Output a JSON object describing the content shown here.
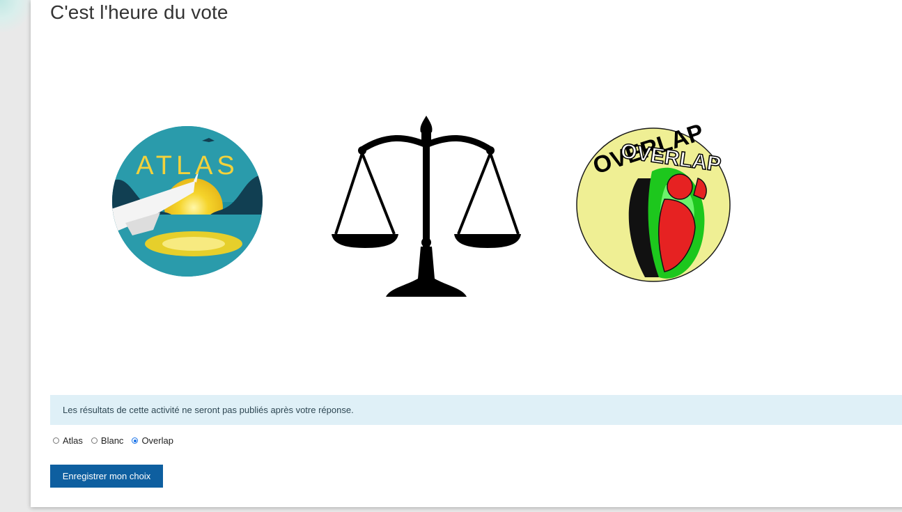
{
  "page": {
    "title": "C'est l'heure du vote"
  },
  "images": [
    {
      "name": "atlas-logo",
      "text": "ATLAS"
    },
    {
      "name": "scales-of-justice-icon"
    },
    {
      "name": "overlap-logo",
      "text": "OVERLAP"
    }
  ],
  "notice": {
    "text": "Les résultats de cette activité ne seront pas publiés après votre réponse."
  },
  "choices": {
    "options": [
      {
        "label": "Atlas",
        "checked": false
      },
      {
        "label": "Blanc",
        "checked": false
      },
      {
        "label": "Overlap",
        "checked": true
      }
    ],
    "selected_value": "Overlap"
  },
  "actions": {
    "submit_label": "Enregistrer mon choix"
  },
  "colors": {
    "button_bg": "#0e5fa0",
    "notice_bg": "#dff0f7",
    "radio_checked": "#1a73e8"
  }
}
